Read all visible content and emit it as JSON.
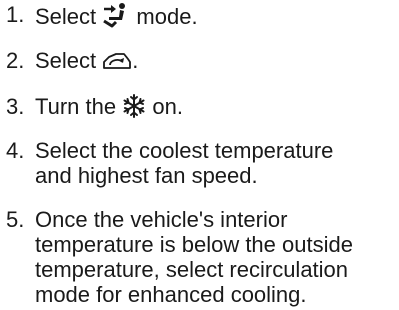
{
  "steps": [
    {
      "number": "1.",
      "before": "Select",
      "icon": "air-outlet-floor-mode-icon",
      "after": "mode."
    },
    {
      "number": "2.",
      "before": "Select",
      "icon": "vehicle-recirculation-icon",
      "after": "."
    },
    {
      "number": "3.",
      "before": "Turn the",
      "icon": "air-conditioning-snowflake-icon",
      "after": "on."
    },
    {
      "number": "4.",
      "lines": [
        "Select the coolest temperature",
        "and highest fan speed."
      ]
    },
    {
      "number": "5.",
      "lines": [
        "Once the vehicle's interior",
        "temperature is below the outside",
        "temperature, select recirculation",
        "mode for enhanced cooling."
      ]
    }
  ]
}
